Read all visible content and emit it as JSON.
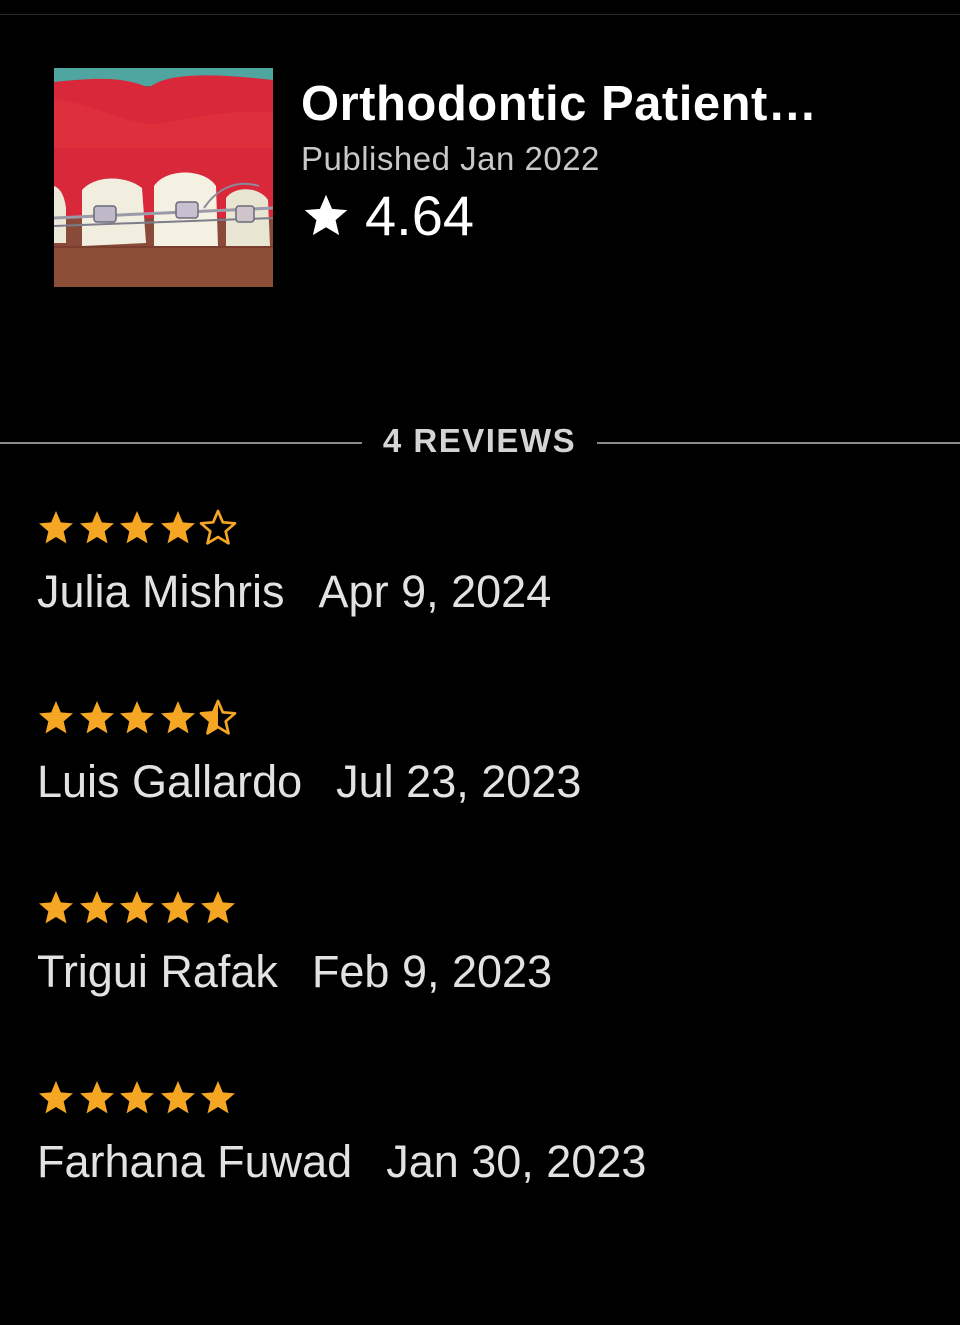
{
  "book": {
    "title": "Orthodontic Patient…",
    "published": "Published Jan 2022",
    "rating": "4.64",
    "thumbnail_icon": "braces-photo"
  },
  "reviews_section": {
    "heading": "4 REVIEWS"
  },
  "colors": {
    "background": "#000000",
    "star_accent": "#F5A623",
    "text": "#E2E2E2"
  },
  "reviews": [
    {
      "reviewer": "Julia Mishris",
      "date": "Apr 9, 2024",
      "stars": 4
    },
    {
      "reviewer": "Luis Gallardo",
      "date": "Jul 23, 2023",
      "stars": 4.5
    },
    {
      "reviewer": "Trigui Rafak",
      "date": "Feb 9, 2023",
      "stars": 5
    },
    {
      "reviewer": "Farhana Fuwad",
      "date": "Jan 30, 2023",
      "stars": 5
    }
  ]
}
